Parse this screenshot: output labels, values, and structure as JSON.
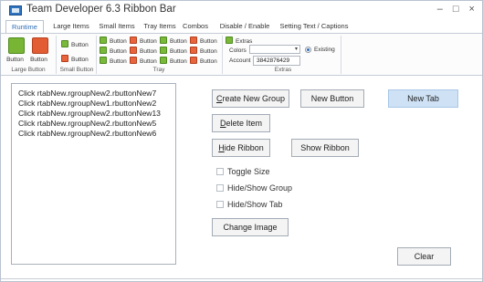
{
  "window": {
    "title": "Team Developer 6.3 Ribbon Bar",
    "controls": "– □ ×"
  },
  "tabs": [
    "Runtime",
    "Large Items",
    "Small Items",
    "Tray Items",
    "Combos",
    "Disable / Enable",
    "Setting Text / Captions"
  ],
  "ribbon": {
    "large_group": {
      "btn1": "Button",
      "btn2": "Button",
      "label": "Large Button"
    },
    "small_group": {
      "btn1": "Button",
      "btn2": "Button",
      "label": "Small Button"
    },
    "tray_group": {
      "button": "Button",
      "label": "Tray"
    },
    "extras": {
      "extras_label": "Extras",
      "colors_label": "Colors",
      "account_label": "Account",
      "account_value": "3842876429",
      "radio_label": "Existing",
      "group_label": "Extras"
    }
  },
  "list": {
    "items": [
      "Click rtabNew.rgroupNew2.rbuttonNew7",
      "Click rtabNew.rgroupNew1.rbuttonNew2",
      "Click rtabNew.rgroupNew2.rbuttonNew13",
      "Click rtabNew.rgroupNew2.rbuttonNew5",
      "Click rtabNew.rgroupNew2.rbuttonNew6"
    ]
  },
  "buttons": {
    "create_group": {
      "pre": "",
      "accel": "C",
      "post": "reate New Group"
    },
    "new_button": "New Button",
    "new_tab": "New Tab",
    "delete_item": {
      "pre": "",
      "accel": "D",
      "post": "elete Item"
    },
    "hide_ribbon": {
      "pre": "",
      "accel": "H",
      "post": "ide Ribbon"
    },
    "show_ribbon": "Show Ribbon",
    "change_image": "Change Image",
    "clear": "Clear"
  },
  "checkboxes": [
    "Toggle Size",
    "Hide/Show Group",
    "Hide/Show Tab"
  ],
  "colors": {
    "accent": "#2e6db5",
    "green_icon": "#7ab83a",
    "orange_icon": "#e7643c",
    "new_tab_bg": "#cfe2f5"
  }
}
